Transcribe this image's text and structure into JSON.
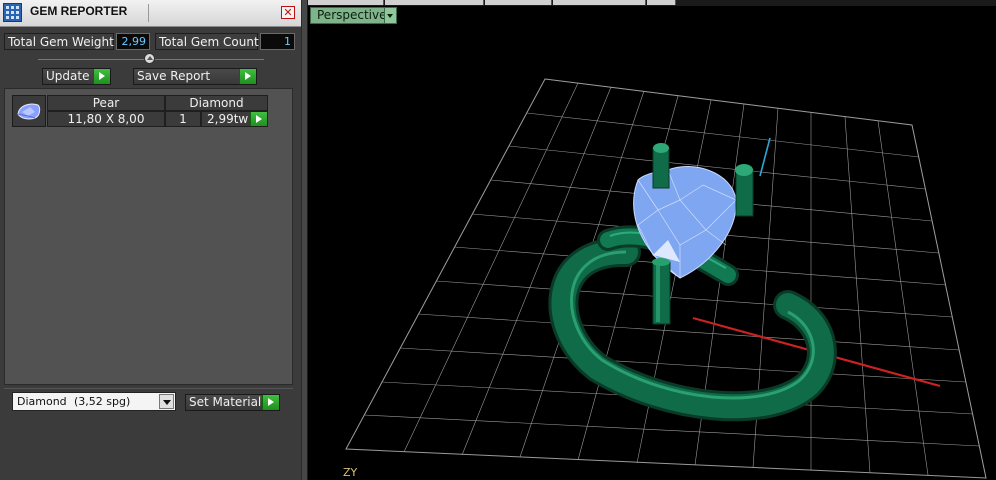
{
  "panel": {
    "title": "GEM REPORTER",
    "close_label": "✕",
    "total_weight_label": "Total Gem Weight",
    "total_weight_value": "2,99",
    "total_count_label": "Total Gem Count",
    "total_count_value": "1",
    "update_label": "Update",
    "save_report_label": "Save Report",
    "table": {
      "header": [
        "Pear",
        "Diamond"
      ],
      "row": {
        "size": "11,80 X 8,00",
        "count": "1",
        "weight": "2,99tw"
      }
    },
    "material": {
      "name": "Diamond",
      "spg": "(3,52 spg)"
    },
    "set_material_label": "Set Material"
  },
  "viewport": {
    "view_label": "Perspective",
    "axis_label": "ZY"
  },
  "colors": {
    "panel_bg": "#3b3b3b",
    "value_text": "#6cc7ff",
    "accent_green": "#2fa82f",
    "grid": "#9a9a9a",
    "ring_metal": "#0f6b48",
    "gem": "#7fa6f0",
    "axis_x": "#cc2222",
    "axis_y": "#2aa9d8"
  }
}
